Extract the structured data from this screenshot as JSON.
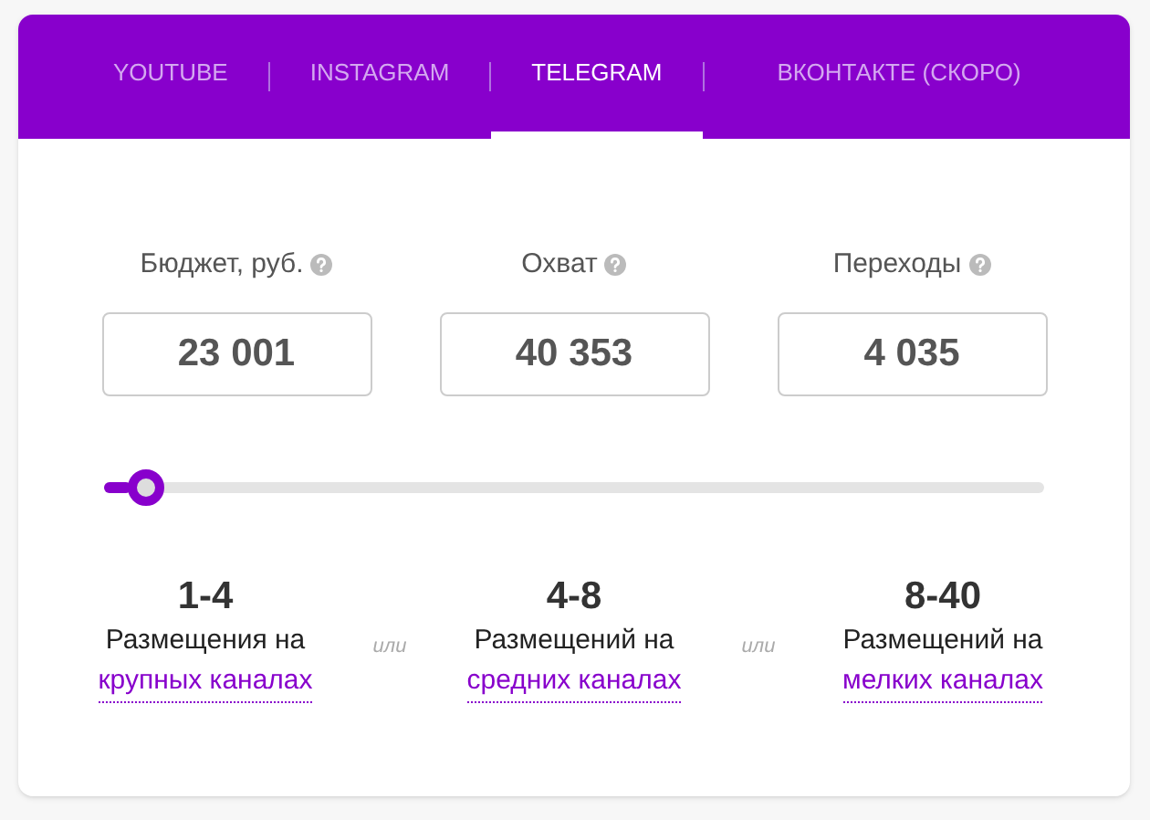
{
  "tabs": [
    {
      "label": "YOUTUBE",
      "selected": false
    },
    {
      "label": "INSTAGRAM",
      "selected": false
    },
    {
      "label": "TELEGRAM",
      "selected": true
    },
    {
      "label": "ВКОНТАКТЕ (СКОРО)",
      "selected": false
    }
  ],
  "fields": [
    {
      "label": "Бюджет, руб.",
      "value": "23 001"
    },
    {
      "label": "Охват",
      "value": "40 353"
    },
    {
      "label": "Переходы",
      "value": "4 035"
    }
  ],
  "slider": {
    "level": 0.03
  },
  "options": [
    {
      "range": "1-4",
      "text": "Размещения на",
      "link": "крупных каналах"
    },
    {
      "range": "4-8",
      "text": "Размещений на",
      "link": "средних каналах"
    },
    {
      "range": "8-40",
      "text": "Размещений на",
      "link": "мелких каналах"
    }
  ],
  "separators": [
    "или",
    "или"
  ]
}
